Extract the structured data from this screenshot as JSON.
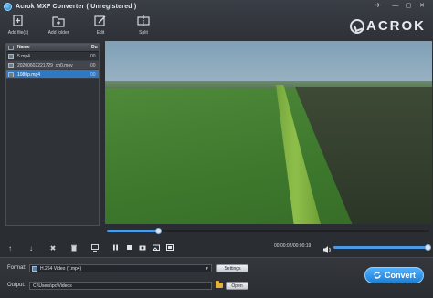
{
  "window": {
    "title": "Acrok MXF Converter ( Unregistered )"
  },
  "toolbar": {
    "add_files": "Add file(s)",
    "add_folder": "Add folder",
    "edit": "Edit",
    "split": "Split"
  },
  "brand": {
    "name": "ACROK"
  },
  "file_list": {
    "headers": {
      "name": "Name",
      "duration": "Du"
    },
    "rows": [
      {
        "name": "5.mp4",
        "duration": "00"
      },
      {
        "name": "20200602221729_ch0.mov",
        "duration": "00"
      },
      {
        "name": "1080p.mp4",
        "duration": "00"
      }
    ],
    "selected_row": "1080p.mp4"
  },
  "player": {
    "timecode": "00:00:02/00:00:19",
    "progress": 0.16,
    "volume": 1.0
  },
  "format": {
    "label": "Format:",
    "value": "H.264 Video (*.mp4)",
    "settings_button": "Settings"
  },
  "output": {
    "label": "Output:",
    "path": "C:\\Users\\pc\\Videos",
    "open_button": "Open"
  },
  "convert_button": "Convert",
  "colors": {
    "accent": "#2f79c4",
    "convert": "#1f7fd6",
    "background": "#2b2e33"
  }
}
